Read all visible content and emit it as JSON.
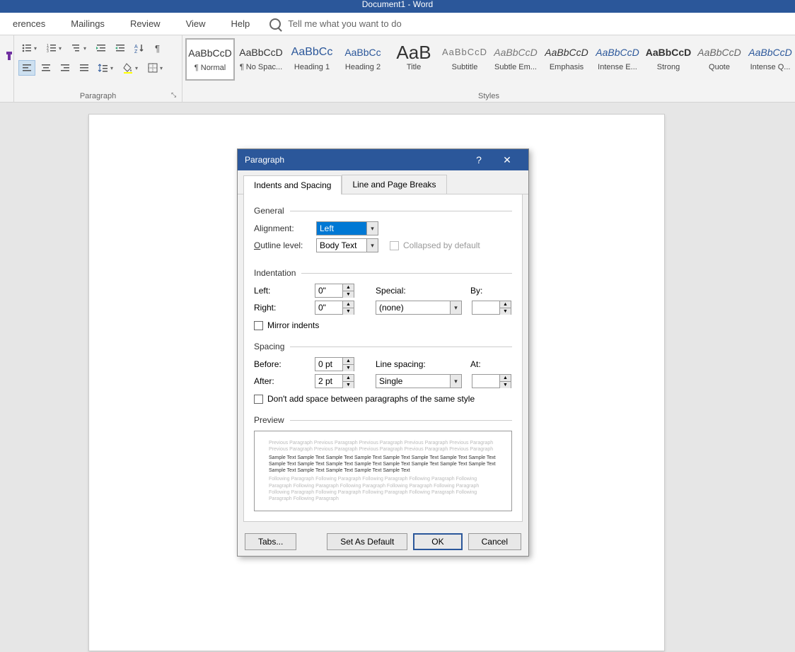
{
  "titlebar": "Document1 - Word",
  "ribbon_tabs": {
    "items": [
      "erences",
      "Mailings",
      "Review",
      "View",
      "Help"
    ],
    "search_placeholder": "Tell me what you want to do"
  },
  "paragraph_group": {
    "label": "Paragraph"
  },
  "styles_group": {
    "label": "Styles",
    "items": [
      {
        "preview": "AaBbCcD",
        "name": "¶ Normal",
        "selected": true,
        "cls": ""
      },
      {
        "preview": "AaBbCcD",
        "name": "¶ No Spac...",
        "cls": ""
      },
      {
        "preview": "AaBbCc",
        "name": "Heading 1",
        "cls": "h1"
      },
      {
        "preview": "AaBbCc",
        "name": "Heading 2",
        "cls": "h2"
      },
      {
        "preview": "AaB",
        "name": "Title",
        "cls": "title"
      },
      {
        "preview": "AaBbCcD",
        "name": "Subtitle",
        "cls": "sub"
      },
      {
        "preview": "AaBbCcD",
        "name": "Subtle Em...",
        "cls": "subtle"
      },
      {
        "preview": "AaBbCcD",
        "name": "Emphasis",
        "cls": "emph"
      },
      {
        "preview": "AaBbCcD",
        "name": "Intense E...",
        "cls": "intense"
      },
      {
        "preview": "AaBbCcD",
        "name": "Strong",
        "cls": "strong"
      },
      {
        "preview": "AaBbCcD",
        "name": "Quote",
        "cls": "quote"
      },
      {
        "preview": "AaBbCcD",
        "name": "Intense Q...",
        "cls": "iq"
      }
    ]
  },
  "dialog": {
    "title": "Paragraph",
    "tabs": {
      "t1": "Indents and Spacing",
      "t2": "Line and Page Breaks"
    },
    "sections": {
      "general": "General",
      "indentation": "Indentation",
      "spacing": "Spacing",
      "preview": "Preview"
    },
    "labels": {
      "alignment": "Alignment:",
      "outline_level": "Outline level:",
      "collapsed": "Collapsed by default",
      "left": "Left:",
      "right": "Right:",
      "special": "Special:",
      "by": "By:",
      "mirror": "Mirror indents",
      "before": "Before:",
      "after": "After:",
      "line_spacing": "Line spacing:",
      "at": "At:",
      "dont_add": "Don't add space between paragraphs of the same style"
    },
    "values": {
      "alignment": "Left",
      "outline_level": "Body Text",
      "left": "0\"",
      "right": "0\"",
      "special": "(none)",
      "by": "",
      "before": "0 pt",
      "after": "2 pt",
      "line_spacing": "Single",
      "at": ""
    },
    "preview_text": {
      "prev": "Previous Paragraph Previous Paragraph Previous Paragraph Previous Paragraph Previous Paragraph Previous Paragraph Previous Paragraph Previous Paragraph Previous Paragraph Previous Paragraph",
      "sample": "Sample Text Sample Text Sample Text Sample Text Sample Text Sample Text Sample Text Sample Text Sample Text Sample Text Sample Text Sample Text Sample Text Sample Text Sample Text Sample Text Sample Text Sample Text Sample Text Sample Text Sample Text",
      "next": "Following Paragraph Following Paragraph Following Paragraph Following Paragraph Following Paragraph Following Paragraph Following Paragraph Following Paragraph Following Paragraph Following Paragraph Following Paragraph Following Paragraph Following Paragraph Following Paragraph Following Paragraph"
    },
    "buttons": {
      "tabs": "Tabs...",
      "default": "Set As Default",
      "ok": "OK",
      "cancel": "Cancel"
    }
  }
}
